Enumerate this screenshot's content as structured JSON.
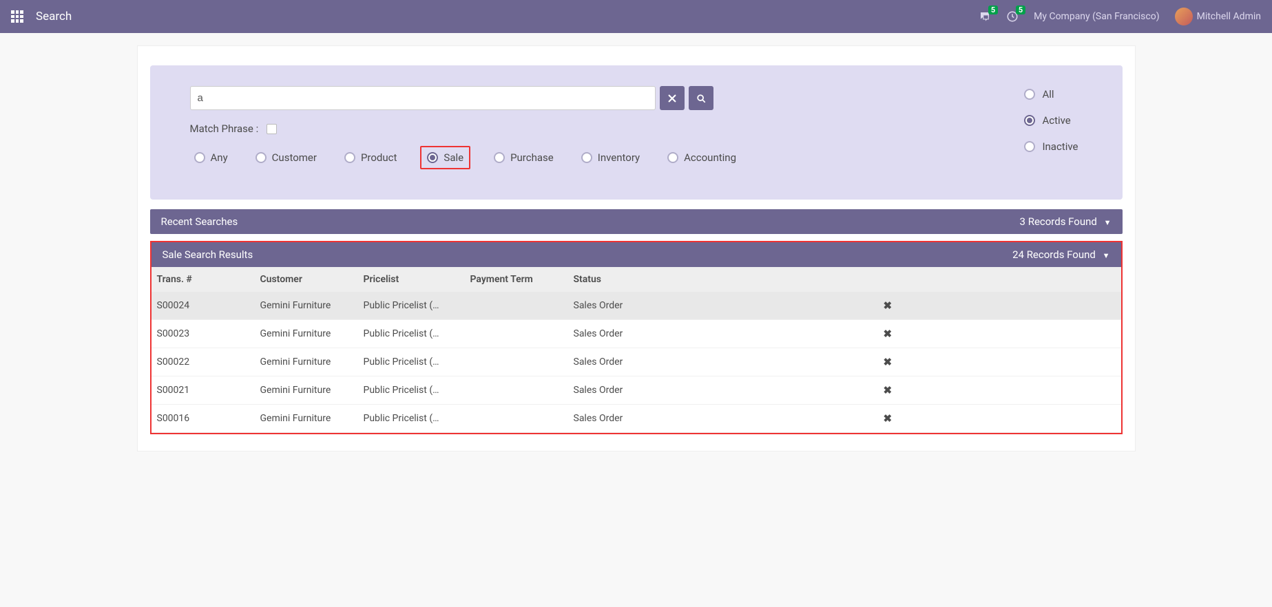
{
  "navbar": {
    "title": "Search",
    "messages_badge": "5",
    "activities_badge": "5",
    "company": "My Company (San Francisco)",
    "username": "Mitchell Admin"
  },
  "search": {
    "input_value": "a",
    "match_phrase_label": "Match Phrase :",
    "type_radios": {
      "any": "Any",
      "customer": "Customer",
      "product": "Product",
      "sale": "Sale",
      "purchase": "Purchase",
      "inventory": "Inventory",
      "accounting": "Accounting",
      "selected": "sale"
    },
    "status_radios": {
      "all": "All",
      "active": "Active",
      "inactive": "Inactive",
      "selected": "active"
    }
  },
  "recent": {
    "title": "Recent Searches",
    "count_text": "3 Records Found"
  },
  "results": {
    "title": "Sale Search Results",
    "count_text": "24 Records Found",
    "columns": {
      "trans": "Trans. #",
      "customer": "Customer",
      "pricelist": "Pricelist",
      "payment_term": "Payment Term",
      "status": "Status"
    },
    "rows": [
      {
        "trans": "S00024",
        "customer": "Gemini Furniture",
        "pricelist": "Public Pricelist (…",
        "payment_term": "",
        "status": "Sales Order"
      },
      {
        "trans": "S00023",
        "customer": "Gemini Furniture",
        "pricelist": "Public Pricelist (…",
        "payment_term": "",
        "status": "Sales Order"
      },
      {
        "trans": "S00022",
        "customer": "Gemini Furniture",
        "pricelist": "Public Pricelist (…",
        "payment_term": "",
        "status": "Sales Order"
      },
      {
        "trans": "S00021",
        "customer": "Gemini Furniture",
        "pricelist": "Public Pricelist (…",
        "payment_term": "",
        "status": "Sales Order"
      },
      {
        "trans": "S00016",
        "customer": "Gemini Furniture",
        "pricelist": "Public Pricelist (…",
        "payment_term": "",
        "status": "Sales Order"
      }
    ]
  }
}
